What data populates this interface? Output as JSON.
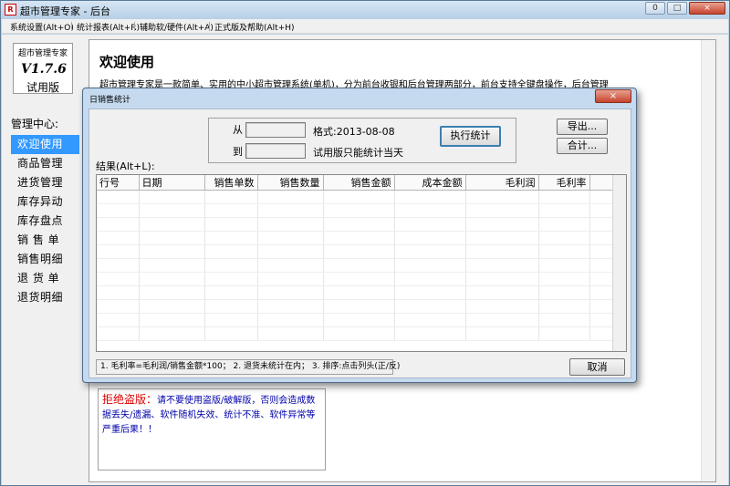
{
  "window": {
    "title": "超市管理专家 - 后台",
    "icon_label": "R",
    "minimize": "0",
    "maximize": "□",
    "close": "×"
  },
  "menu": [
    "系统设置(Alt+O)",
    "统计报表(Alt+R)",
    "辅助软/硬件(Alt+A)",
    "正式版及帮助(Alt+H)"
  ],
  "logo": {
    "name": "超市管理专家",
    "version": "V1.7.6",
    "edition": "试用版"
  },
  "sidebar": {
    "title": "管理中心:",
    "items": [
      "欢迎使用",
      "商品管理",
      "进货管理",
      "库存异动",
      "库存盘点",
      "销 售 单",
      "销售明细",
      "退 货 单",
      "退货明细"
    ],
    "active_index": 0
  },
  "main": {
    "title": "欢迎使用",
    "intro": "超市管理专家是一款简单、实用的中小超市管理系统(单机)，分为前台收银和后台管理两部分，前台支持全键盘操作，后台管理",
    "warning_head": "拒绝盗版：",
    "warning_text": "请不要使用盗版/破解版，否则会造成数据丢失/遗漏、软件随机失效、统计不准、软件异常等严重后果！！"
  },
  "dialog": {
    "title": "日销售统计",
    "from_label": "从",
    "to_label": "到",
    "format_label": "格式:2013-08-08",
    "trial_note": "试用版只能统计当天",
    "from_value": "",
    "to_value": "",
    "run_button": "执行统计",
    "export_button": "导出...",
    "total_button": "合计...",
    "result_label": "结果(Alt+L):",
    "columns": [
      "行号",
      "日期",
      "销售单数",
      "销售数量",
      "销售金额",
      "成本金额",
      "毛利润",
      "毛利率"
    ],
    "note": "1. 毛利率=毛利润/销售金额*100； 2. 退货未统计在内； 3. 排序:点击列头(正/反)",
    "cancel_button": "取消",
    "close": "×"
  }
}
